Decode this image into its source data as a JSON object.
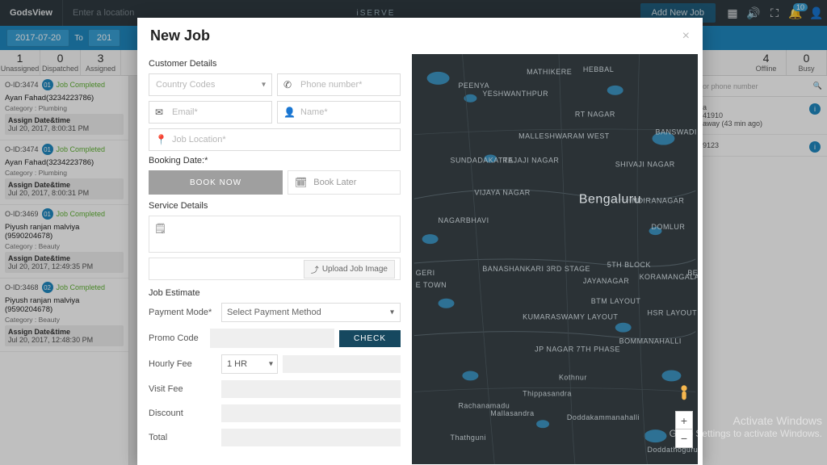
{
  "topnav": {
    "brand": "GodsView",
    "location_placeholder": "Enter a location",
    "iserve": "iSERVE",
    "add_job": "Add New Job",
    "bell_count": "10"
  },
  "subbar": {
    "date_from": "2017-07-20",
    "to": "To",
    "date_to_partial": "201"
  },
  "stats": {
    "left": [
      {
        "n": "1",
        "lbl": "Unassigned"
      },
      {
        "n": "0",
        "lbl": "Dispatched"
      },
      {
        "n": "3",
        "lbl": "Assigned"
      }
    ],
    "right": [
      {
        "n": "4",
        "lbl": "Offline"
      },
      {
        "n": "0",
        "lbl": "Busy"
      }
    ]
  },
  "jobs": [
    {
      "oid": "O-ID:3474",
      "badge": "01",
      "status": "Job Completed",
      "name": "Ayan Fahad(3234223786)",
      "cat": "Category : Plumbing",
      "asg_t": "Assign Date&time",
      "asg_d": "Jul 20, 2017, 8:00:31 PM"
    },
    {
      "oid": "O-ID:3474",
      "badge": "01",
      "status": "Job Completed",
      "name": "Ayan Fahad(3234223786)",
      "cat": "Category : Plumbing",
      "asg_t": "Assign Date&time",
      "asg_d": "Jul 20, 2017, 8:00:31 PM"
    },
    {
      "oid": "O-ID:3469",
      "badge": "01",
      "status": "Job Completed",
      "name": "Piyush ranjan malviya (9590204678)",
      "cat": "Category : Beauty",
      "asg_t": "Assign Date&time",
      "asg_d": "Jul 20, 2017, 12:49:35 PM"
    },
    {
      "oid": "O-ID:3468",
      "badge": "02",
      "status": "Job Completed",
      "name": "Piyush ranjan malviya (9590204678)",
      "cat": "Category : Beauty",
      "asg_t": "Assign Date&time",
      "asg_d": "Jul 20, 2017, 12:48:30 PM"
    }
  ],
  "rightpanel": {
    "search_placeholder": "or phone number",
    "items": [
      {
        "line1": "a",
        "line2": "41910",
        "line3": "away (43 min ago)"
      },
      {
        "line1": "",
        "line2": "9123",
        "line3": ""
      }
    ]
  },
  "modal": {
    "title": "New Job",
    "customer_details": "Customer Details",
    "country_placeholder": "Country Codes",
    "phone_placeholder": "Phone number*",
    "email_placeholder": "Email*",
    "name_placeholder": "Name*",
    "location_placeholder": "Job Location*",
    "booking_date": "Booking Date:*",
    "book_now": "BOOK NOW",
    "book_later": "Book Later",
    "service_details": "Service Details",
    "upload": "Upload Job Image",
    "job_estimate": "Job Estimate",
    "payment_mode": "Payment Mode*",
    "payment_select": "Select Payment Method",
    "promo_code": "Promo Code",
    "check": "CHECK",
    "hourly_fee": "Hourly Fee",
    "hourly_val": "1 HR",
    "visit_fee": "Visit Fee",
    "discount": "Discount",
    "total": "Total"
  },
  "map": {
    "city": "Bengaluru",
    "labels": [
      "MATHIKERE",
      "HEBBAL",
      "PEENYA",
      "YESHWANTHPUR",
      "RT NAGAR",
      "BANSWADI",
      "SUNDADAKATTE",
      "RAJAJI NAGAR",
      "MALLESHWARAM WEST",
      "SHIVAJI NAGAR",
      "INDIRANAGAR",
      "VIJAYA NAGAR",
      "NAGARBHAVI",
      "DOMLUR",
      "BANASHANKARI 3RD STAGE",
      "5TH BLOCK",
      "KORAMANGALA",
      "JAYANAGAR",
      "BTM LAYOUT",
      "HSR LAYOUT",
      "KUMARASWAMY LAYOUT",
      "BOMMANAHALLI",
      "JP NAGAR 7TH PHASE",
      "Kothnur",
      "Thippasandra",
      "Doddakammanahalli",
      "Mallasandra",
      "Rachanamadu",
      "Thathguni",
      "Doddathoguru",
      "GERI",
      "E TOWN",
      "BE"
    ]
  },
  "watermark": {
    "l1": "Activate Windows",
    "l2": "Go to Settings to activate Windows."
  }
}
